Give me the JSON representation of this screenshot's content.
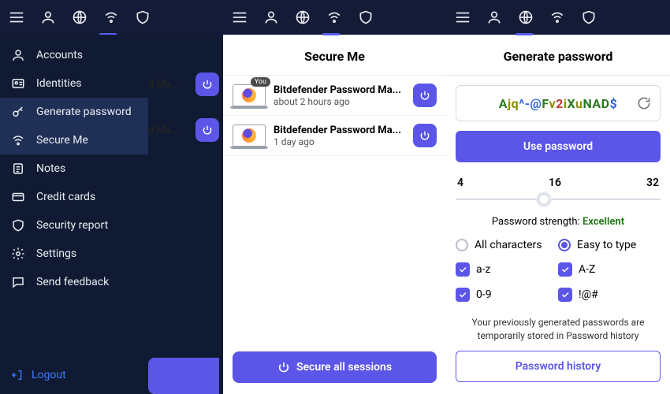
{
  "sidebar": {
    "items": [
      {
        "label": "Accounts"
      },
      {
        "label": "Identities"
      },
      {
        "label": "Generate password"
      },
      {
        "label": "Secure Me"
      },
      {
        "label": "Notes"
      },
      {
        "label": "Credit cards"
      },
      {
        "label": "Security report"
      },
      {
        "label": "Settings"
      },
      {
        "label": "Send feedback"
      }
    ],
    "logout": "Logout"
  },
  "peek": {
    "row1": "d Ma...",
    "row2": "d Ma..."
  },
  "secure_me": {
    "title": "Secure Me",
    "you_badge": "You",
    "sessions": [
      {
        "name": "Bitdefender Password Ma...",
        "time": "about 2 hours ago"
      },
      {
        "name": "Bitdefender Password Ma...",
        "time": "1 day ago"
      }
    ],
    "secure_all": "Secure all sessions"
  },
  "gen": {
    "title": "Generate password",
    "password_chars": [
      {
        "c": "A",
        "t": "upper"
      },
      {
        "c": "j",
        "t": "lower"
      },
      {
        "c": "q",
        "t": "lower"
      },
      {
        "c": "^",
        "t": "sym"
      },
      {
        "c": "-",
        "t": "sym"
      },
      {
        "c": "@",
        "t": "sym"
      },
      {
        "c": "F",
        "t": "upper"
      },
      {
        "c": "v",
        "t": "lower"
      },
      {
        "c": "2",
        "t": "digit"
      },
      {
        "c": "i",
        "t": "lower"
      },
      {
        "c": "X",
        "t": "upper"
      },
      {
        "c": "u",
        "t": "lower"
      },
      {
        "c": "N",
        "t": "upper"
      },
      {
        "c": "A",
        "t": "upper"
      },
      {
        "c": "D",
        "t": "upper"
      },
      {
        "c": "$",
        "t": "sym"
      }
    ],
    "use_password": "Use password",
    "slider": {
      "min": "4",
      "mid": "16",
      "max": "32",
      "value": 16
    },
    "strength_label": "Password strength: ",
    "strength_value": "Excellent",
    "opts": {
      "all_chars": "All characters",
      "easy_type": "Easy to type",
      "az": "a-z",
      "AZ": "A-Z",
      "digits": "0-9",
      "symbols": "!@#"
    },
    "history_note": "Your previously generated passwords are temporarily stored in Password history",
    "history_btn": "Password history"
  },
  "colors": {
    "char_upper": "#2a7a1f",
    "char_lower": "#8a8f00",
    "char_digit": "#c23a2e",
    "char_sym": "#2d5fe0",
    "strength": "#2a7a1f"
  }
}
